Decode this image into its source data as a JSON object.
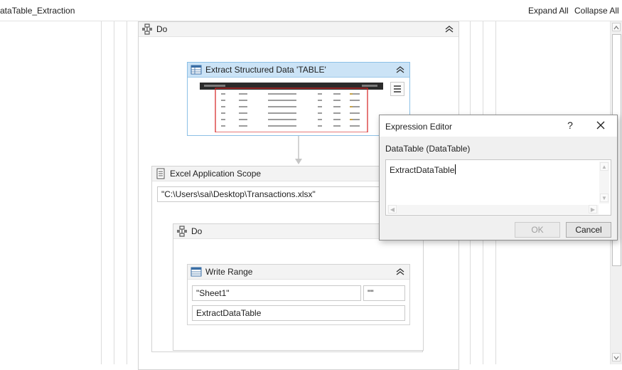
{
  "header": {
    "workflow_title": "ataTable_Extraction",
    "expand_all": "Expand All",
    "collapse_all": "Collapse All"
  },
  "designer": {
    "outer_sequence": {
      "title": "Do",
      "icon": "sequence-icon"
    },
    "extract_activity": {
      "title": "Extract Structured Data 'TABLE'",
      "icon": "extract-data-icon",
      "menu_icon": "hamburger-menu-icon"
    },
    "excel_scope": {
      "title": "Excel Application Scope",
      "icon": "excel-scope-icon",
      "file_path": "\"C:\\Users\\sai\\Desktop\\Transactions.xlsx\""
    },
    "inner_sequence": {
      "title": "Do",
      "icon": "sequence-icon"
    },
    "write_range": {
      "title": "Write Range",
      "icon": "write-range-icon",
      "sheet": "\"Sheet1\"",
      "range": "\"\"",
      "datatable": "ExtractDataTable"
    }
  },
  "dialog": {
    "title": "Expression Editor",
    "help": "?",
    "label": "DataTable (DataTable)",
    "expression": "ExtractDataTable",
    "ok_label": "OK",
    "cancel_label": "Cancel"
  }
}
